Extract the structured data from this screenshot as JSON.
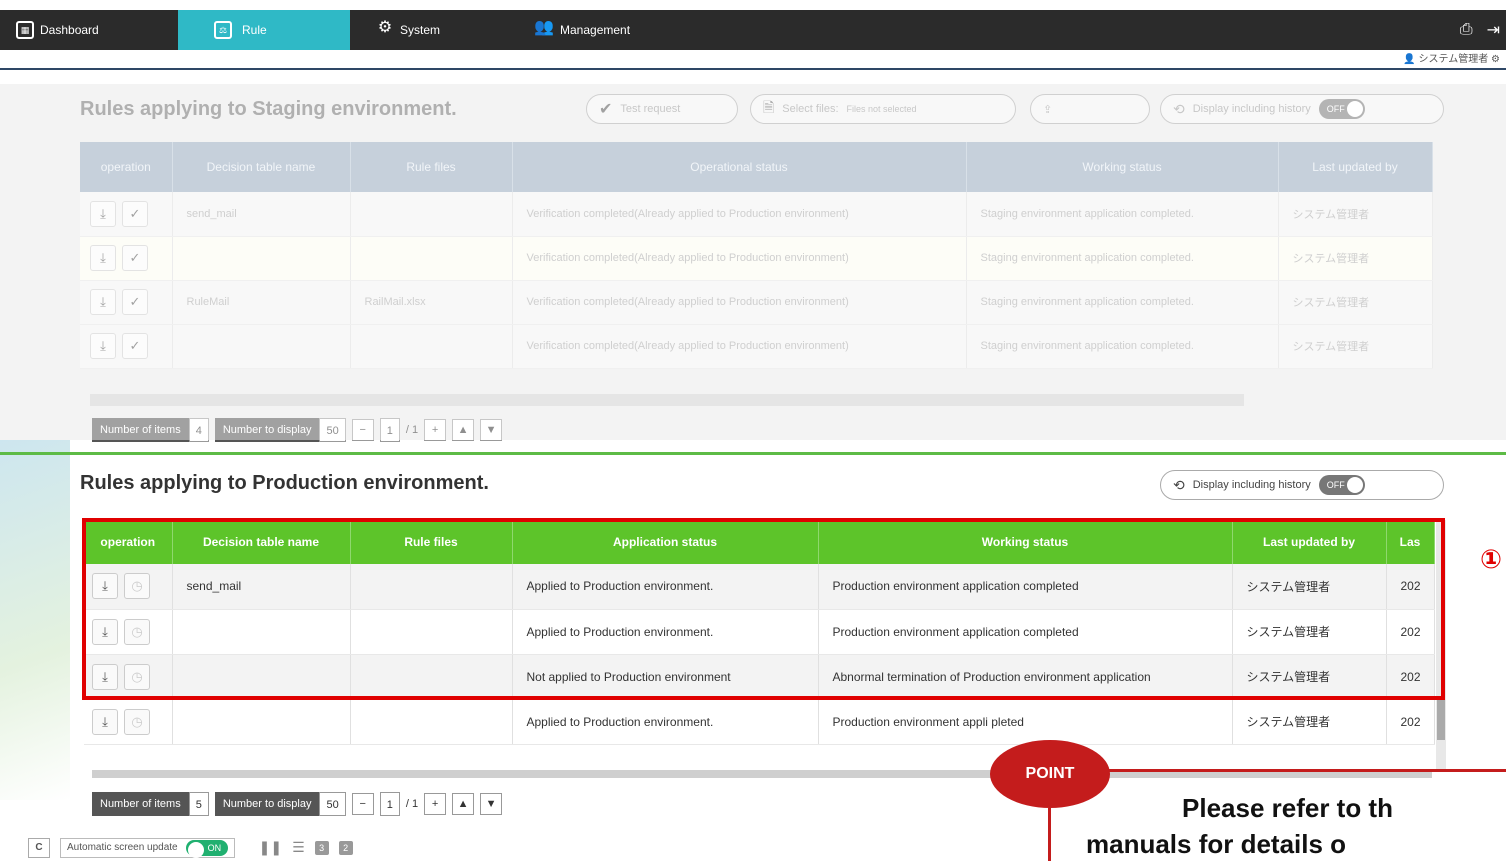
{
  "nav": {
    "tabs": [
      {
        "label": "Dashboard",
        "icon": "dashboard-icon"
      },
      {
        "label": "Rule",
        "icon": "scale-icon"
      },
      {
        "label": "System",
        "icon": "gears-icon"
      },
      {
        "label": "Management",
        "icon": "users-icon"
      }
    ],
    "active_tab": "Rule",
    "accent": "#2fb9c6"
  },
  "user": {
    "name": "システム管理者"
  },
  "staging": {
    "title": "Rules applying to Staging environment.",
    "test_request": "Test request",
    "select_files_label": "Select files:",
    "files_not_selected": "Files not selected",
    "display_history": "Display including history",
    "toggle_state": "OFF",
    "columns": [
      "operation",
      "Decision table name",
      "Rule files",
      "Operational status",
      "Working status",
      "Last updated by"
    ],
    "rows": [
      {
        "name": "send_mail",
        "file": "",
        "status": "Verification completed(Already applied to Production environment)",
        "working": "Staging environment application completed.",
        "user": "システム管理者"
      },
      {
        "name": "",
        "file": "",
        "status": "Verification completed(Already applied to Production environment)",
        "working": "Staging environment application completed.",
        "user": "システム管理者"
      },
      {
        "name": "RuleMail",
        "file": "RailMail.xlsx",
        "status": "Verification completed(Already applied to Production environment)",
        "working": "Staging environment application completed.",
        "user": "システム管理者"
      },
      {
        "name": "",
        "file": "",
        "status": "Verification completed(Already applied to Production environment)",
        "working": "Staging environment application completed.",
        "user": "システム管理者"
      }
    ],
    "pager": {
      "items_label": "Number of items",
      "items": "4",
      "display_label": "Number to display",
      "display": "50",
      "page": "1",
      "total": "/ 1"
    }
  },
  "production": {
    "title": "Rules applying to Production environment.",
    "display_history": "Display including history",
    "toggle_state": "OFF",
    "columns": [
      "operation",
      "Decision table name",
      "Rule files",
      "Application status",
      "Working status",
      "Last updated by",
      "Las"
    ],
    "rows": [
      {
        "name": "send_mail",
        "file": "",
        "status": "Applied to Production environment.",
        "working": "Production environment application completed",
        "user": "システム管理者",
        "date": "202"
      },
      {
        "name": "",
        "file": "",
        "status": "Applied to Production environment.",
        "working": "Production environment application completed",
        "user": "システム管理者",
        "date": "202"
      },
      {
        "name": "",
        "file": "",
        "status": "Not applied to Production environment",
        "working": "Abnormal termination of Production environment application",
        "user": "システム管理者",
        "date": "202"
      },
      {
        "name": "",
        "file": "",
        "status": "Applied to Production environment.",
        "working": "Production environment appli      pleted",
        "user": "システム管理者",
        "date": "202"
      }
    ],
    "pager": {
      "items_label": "Number of items",
      "items": "5",
      "display_label": "Number to display",
      "display": "50",
      "page": "1",
      "total": "/ 1"
    },
    "highlight_marker": "①"
  },
  "point": {
    "label": "POINT",
    "note_line1": "Please refer to th",
    "note_line2": "manuals for details o"
  },
  "bottom": {
    "refresh": "C",
    "auto_update": "Automatic screen update",
    "auto_state": "ON",
    "view_3": "3",
    "view_2": "2"
  }
}
